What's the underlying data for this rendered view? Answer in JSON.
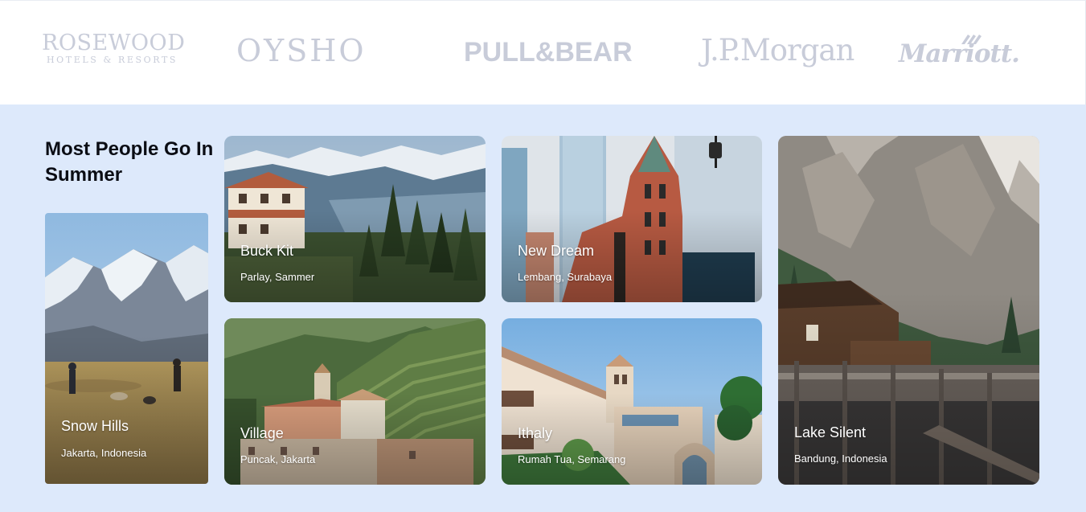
{
  "brands": {
    "rosewood_main": "ROSEWOOD",
    "rosewood_sub": "HOTELS & RESORTS",
    "oysho": "OYSHO",
    "pullbear": "PULL&BEAR",
    "jpmorgan": "J.P.Morgan",
    "marriott": "Marriott."
  },
  "section": {
    "title": "Most People Go In Summer"
  },
  "destinations": {
    "snow": {
      "title": "Snow Hills",
      "place": "Jakarta, Indonesia"
    },
    "buck": {
      "title": "Buck Kit",
      "place": "Parlay, Sammer"
    },
    "dream": {
      "title": "New Dream",
      "place": "Lembang, Surabaya"
    },
    "lake": {
      "title": "Lake Silent",
      "place": "Bandung, Indonesia"
    },
    "village": {
      "title": "Village",
      "place": "Puncak, Jakarta"
    },
    "ithaly": {
      "title": "Ithaly",
      "place": "Rumah Tua, Semarang"
    }
  },
  "colors": {
    "page_background": "#dde9fb",
    "brand_strip": "#ffffff",
    "brand_logo_gray": "#c8ccd9",
    "heading": "#0b0d14",
    "card_text": "#ffffff"
  },
  "icons": {
    "marriott_mark": "marriott-emblem-icon"
  }
}
